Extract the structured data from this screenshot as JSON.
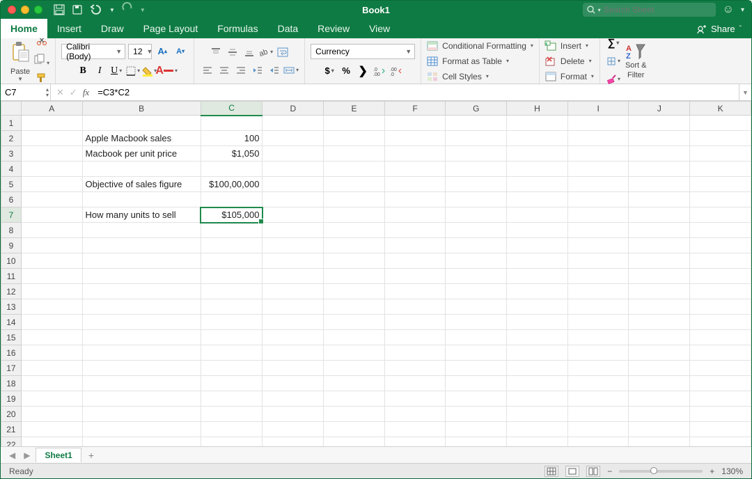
{
  "window": {
    "title": "Book1"
  },
  "search": {
    "placeholder": "Search Sheet"
  },
  "tabs": {
    "items": [
      "Home",
      "Insert",
      "Draw",
      "Page Layout",
      "Formulas",
      "Data",
      "Review",
      "View"
    ],
    "share": "Share"
  },
  "ribbon": {
    "paste": "Paste",
    "font_name": "Calibri (Body)",
    "font_size": "12",
    "number_format": "Currency",
    "cf": "Conditional Formatting",
    "fat": "Format as Table",
    "cs": "Cell Styles",
    "insert": "Insert",
    "delete": "Delete",
    "format": "Format",
    "sortfilter_l1": "Sort &",
    "sortfilter_l2": "Filter"
  },
  "fbar": {
    "name": "C7",
    "formula": "=C3*C2"
  },
  "grid": {
    "cols": [
      "A",
      "B",
      "C",
      "D",
      "E",
      "F",
      "G",
      "H",
      "I",
      "J",
      "K"
    ],
    "rows": 22,
    "selected_row": 7,
    "selected_col": "C",
    "cells": {
      "B2": "Apple Macbook sales",
      "C2": "100",
      "B3": "Macbook per unit price",
      "C3": "$1,050",
      "B5": "Objective of sales figure",
      "C5": "$100,00,000",
      "B7": "How many units to sell",
      "C7": "$105,000"
    }
  },
  "sheetbar": {
    "sheet": "Sheet1"
  },
  "status": {
    "ready": "Ready",
    "zoom": "130%"
  }
}
